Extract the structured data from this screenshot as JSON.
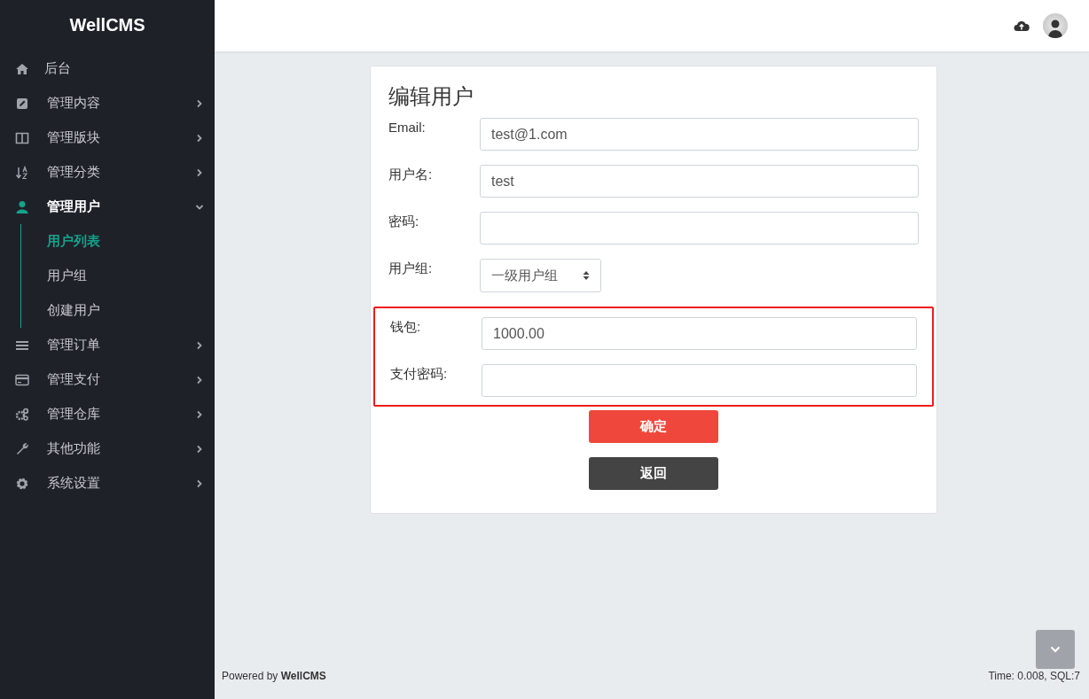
{
  "sidebar": {
    "logo": "WellCMS",
    "items": [
      {
        "label": "后台",
        "kind": "link",
        "selected": false
      },
      {
        "label": "管理内容",
        "kind": "menu",
        "expanded": false,
        "selected": false
      },
      {
        "label": "管理版块",
        "kind": "menu",
        "expanded": false,
        "selected": false
      },
      {
        "label": "管理分类",
        "kind": "menu",
        "expanded": false,
        "selected": false
      },
      {
        "label": "管理用户",
        "kind": "menu",
        "expanded": true,
        "selected": true,
        "children": [
          {
            "label": "用户列表",
            "selected": true
          },
          {
            "label": "用户组",
            "selected": false
          },
          {
            "label": "创建用户",
            "selected": false
          }
        ]
      },
      {
        "label": "管理订单",
        "kind": "menu",
        "expanded": false,
        "selected": false
      },
      {
        "label": "管理支付",
        "kind": "menu",
        "expanded": false,
        "selected": false
      },
      {
        "label": "管理仓库",
        "kind": "menu",
        "expanded": false,
        "selected": false
      },
      {
        "label": "其他功能",
        "kind": "menu",
        "expanded": false,
        "selected": false
      },
      {
        "label": "系统设置",
        "kind": "menu",
        "expanded": false,
        "selected": false
      }
    ]
  },
  "form": {
    "title": "编辑用户",
    "fields": [
      {
        "label": "Email:",
        "kind": "text",
        "value": "test@1.com",
        "highlighted": false
      },
      {
        "label": "用户名:",
        "kind": "text",
        "value": "test",
        "highlighted": false
      },
      {
        "label": "密码:",
        "kind": "text",
        "highlighted": false
      },
      {
        "label": "用户组:",
        "kind": "select",
        "value": "一级用户组",
        "highlighted": false
      },
      {
        "label": "钱包:",
        "kind": "text",
        "value": "1000.00",
        "highlighted": true
      },
      {
        "label": "支付密码:",
        "kind": "text",
        "highlighted": true
      }
    ],
    "buttons": [
      {
        "label": "确定",
        "kind": "primary"
      },
      {
        "label": "返回",
        "kind": "secondary"
      }
    ]
  },
  "footer": {
    "powered": "Powered by **WellCMS**",
    "stats": "Time: 0.008, SQL:7"
  }
}
